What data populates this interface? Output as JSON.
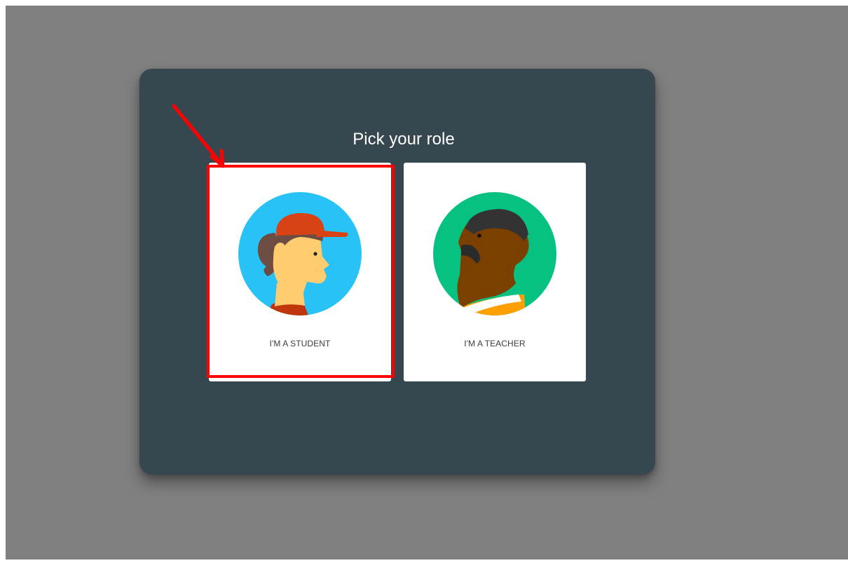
{
  "dialog": {
    "title": "Pick your role"
  },
  "roles": [
    {
      "label": "I'M A STUDENT",
      "icon": "student-avatar-icon"
    },
    {
      "label": "I'M A TEACHER",
      "icon": "teacher-avatar-icon"
    }
  ],
  "annotation": {
    "color": "#ff0000",
    "target": "I'M A STUDENT"
  },
  "colors": {
    "dialog_background": "#37474f",
    "backdrop": "#808080",
    "student_avatar_bg": "#29c2f7",
    "teacher_avatar_bg": "#06c17f"
  }
}
